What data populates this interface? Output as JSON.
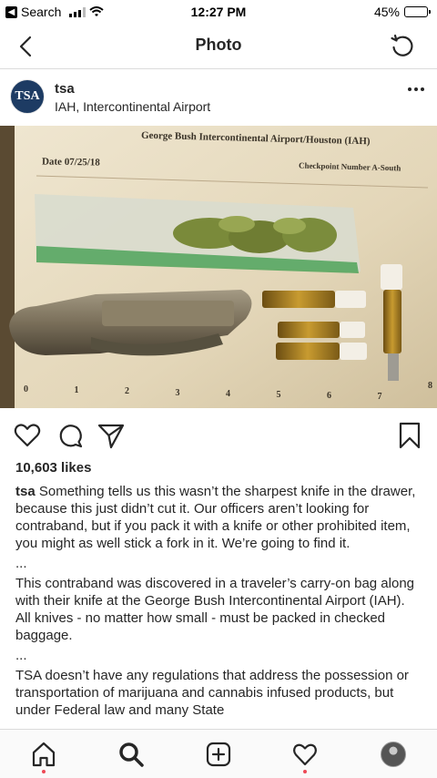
{
  "status_bar": {
    "back_app": "Search",
    "time": "12:27 PM",
    "battery": "45%",
    "battery_level": 0.45
  },
  "nav": {
    "title": "Photo"
  },
  "post": {
    "avatar_text": "TSA",
    "username": "tsa",
    "location": "IAH, Intercontinental Airport",
    "photo": {
      "header": "George Bush Intercontinental Airport/Houston (IAH)",
      "date": "Date 07/25/18",
      "checkpoint": "Checkpoint Number A-South",
      "ruler": [
        "0",
        "1",
        "2",
        "3",
        "4",
        "5",
        "6",
        "7",
        "8"
      ]
    },
    "likes": "10,603 likes",
    "caption": {
      "user": "tsa",
      "p1": "Something tells us this wasn’t the sharpest knife in the drawer, because this just didn’t cut it. Our officers aren’t looking for contraband, but if you pack it with a knife or other prohibited item, you might as well stick a fork in it. We’re going to find it.",
      "sep1": "...",
      "p2": "This contraband was discovered in a traveler’s carry-on bag along with their knife at the George Bush Intercontinental Airport (IAH). All knives - no matter how small - must be packed in checked baggage.",
      "sep2": "...",
      "p3": "TSA doesn’t have any regulations that address the possession or transportation of marijuana and cannabis infused products, but under Federal law and many State"
    }
  },
  "colors": {
    "text": "#262626",
    "border": "#dbdbdb",
    "notification": "#ed4956",
    "tsa_blue": "#1d3b63"
  }
}
